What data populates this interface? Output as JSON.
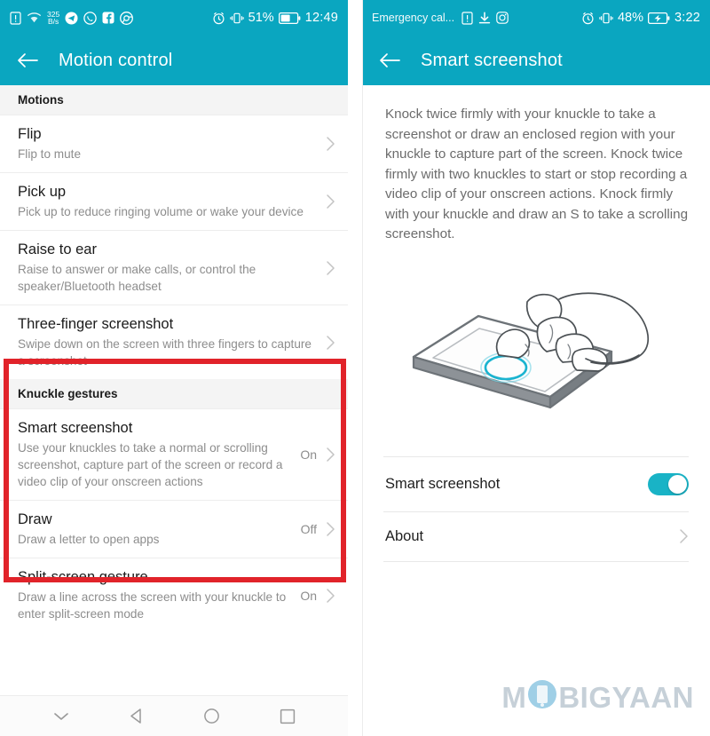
{
  "left_screen": {
    "status_bar": {
      "icons_left": [
        "sim-warning-icon",
        "wifi-icon",
        "telegram-icon",
        "whatsapp-icon",
        "facebook-icon",
        "chrome-icon"
      ],
      "data_rate_value": "325",
      "data_rate_unit": "B/s",
      "icons_right": [
        "alarm-icon",
        "vibrate-icon",
        "battery-icon"
      ],
      "battery_percent": "51%",
      "clock": "12:49"
    },
    "appbar": {
      "back_icon": "back-arrow-icon",
      "title": "Motion control"
    },
    "sections": [
      {
        "header": "Motions",
        "items": [
          {
            "title": "Flip",
            "subtitle": "Flip to mute",
            "value": ""
          },
          {
            "title": "Pick up",
            "subtitle": "Pick up to reduce ringing volume or wake your device",
            "value": ""
          },
          {
            "title": "Raise to ear",
            "subtitle": "Raise to answer or make calls, or control the speaker/Bluetooth headset",
            "value": ""
          },
          {
            "title": "Three-finger screenshot",
            "subtitle": "Swipe down on the screen with three fingers to capture a screenshot",
            "value": ""
          }
        ]
      },
      {
        "header": "Knuckle gestures",
        "highlighted": true,
        "items": [
          {
            "title": "Smart screenshot",
            "subtitle": "Use your knuckles to take a normal or scrolling screenshot, capture part of the screen or record a video clip of your onscreen actions",
            "value": "On"
          },
          {
            "title": "Draw",
            "subtitle": "Draw a letter to open apps",
            "value": "Off"
          },
          {
            "title": "Split-screen gesture",
            "subtitle": "Draw a line across the screen with your knuckle to enter split-screen mode",
            "value": "On"
          }
        ]
      }
    ],
    "nav_bar": [
      "chevron-down-icon",
      "back-triangle-icon",
      "home-circle-icon",
      "recents-square-icon"
    ]
  },
  "right_screen": {
    "status_bar": {
      "carrier": "Emergency cal...",
      "icons_left": [
        "sim-warning-icon",
        "download-icon",
        "instagram-icon"
      ],
      "icons_right": [
        "alarm-icon",
        "vibrate-icon",
        "battery-charging-icon"
      ],
      "battery_percent": "48%",
      "clock": "3:22"
    },
    "appbar": {
      "back_icon": "back-arrow-icon",
      "title": "Smart screenshot"
    },
    "description": "Knock twice firmly with your knuckle to take a screenshot or draw an enclosed region with your knuckle to capture part of the screen. Knock twice firmly with two knuckles to start or stop recording a video clip of your onscreen actions. Knock firmly with your knuckle and draw an S to take a scrolling screenshot.",
    "illustration": "knuckle-knock-phone-illustration",
    "rows": [
      {
        "label": "Smart screenshot",
        "control": "toggle",
        "state": "on"
      },
      {
        "label": "About",
        "control": "chevron",
        "state": ""
      }
    ]
  },
  "watermark": {
    "text_before": "M",
    "text_o": "O",
    "text_after": "BIGYAAN"
  },
  "colors": {
    "accent_teal": "#0AA6C0",
    "toggle_on": "#19B3C6",
    "highlight_red": "#E1232A",
    "section_bg": "#f4f4f4",
    "subtitle_gray": "#8d8d8d",
    "watermark_gray": "#c6d0d8"
  }
}
